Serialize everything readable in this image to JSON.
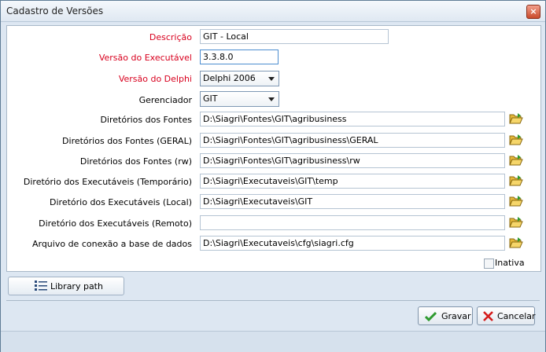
{
  "window": {
    "title": "Cadastro de Versões",
    "close_label": "×"
  },
  "fields": {
    "descricao": {
      "label": "Descrição",
      "value": "GIT - Local"
    },
    "versao_executavel": {
      "label": "Versão do Executável",
      "value": "3.3.8.0"
    },
    "versao_delphi": {
      "label": "Versão do Delphi",
      "value": "Delphi 2006"
    },
    "gerenciador": {
      "label": "Gerenciador",
      "value": "GIT"
    },
    "dir_fontes": {
      "label": "Diretórios dos Fontes",
      "value": "D:\\Siagri\\Fontes\\GIT\\agribusiness"
    },
    "dir_fontes_geral": {
      "label": "Diretórios dos Fontes (GERAL)",
      "value": "D:\\Siagri\\Fontes\\GIT\\agribusiness\\GERAL"
    },
    "dir_fontes_rw": {
      "label": "Diretórios dos Fontes (rw)",
      "value": "D:\\Siagri\\Fontes\\GIT\\agribusiness\\rw"
    },
    "dir_exec_temp": {
      "label": "Diretório dos Executáveis (Temporário)",
      "value": "D:\\Siagri\\Executaveis\\GIT\\temp"
    },
    "dir_exec_local": {
      "label": "Diretório dos Executáveis (Local)",
      "value": "D:\\Siagri\\Executaveis\\GIT"
    },
    "dir_exec_remoto": {
      "label": "Diretório dos Executáveis (Remoto)",
      "value": ""
    },
    "arquivo_conexao": {
      "label": "Arquivo de conexão a base de dados",
      "value": "D:\\Siagri\\Executaveis\\cfg\\siagri.cfg"
    }
  },
  "inativa": {
    "label": "Inativa",
    "checked": false
  },
  "buttons": {
    "library": "Library path",
    "gravar": "Gravar",
    "cancelar": "Cancelar"
  },
  "icons": {
    "folder": "folder-open-icon",
    "list": "list-icon",
    "check": "check-icon",
    "cancel": "cancel-x-icon"
  },
  "colors": {
    "required_label": "#d8001e",
    "background": "#dde7f2",
    "accent_check": "#2f9a2f",
    "cancel_red": "#d41a1a"
  }
}
